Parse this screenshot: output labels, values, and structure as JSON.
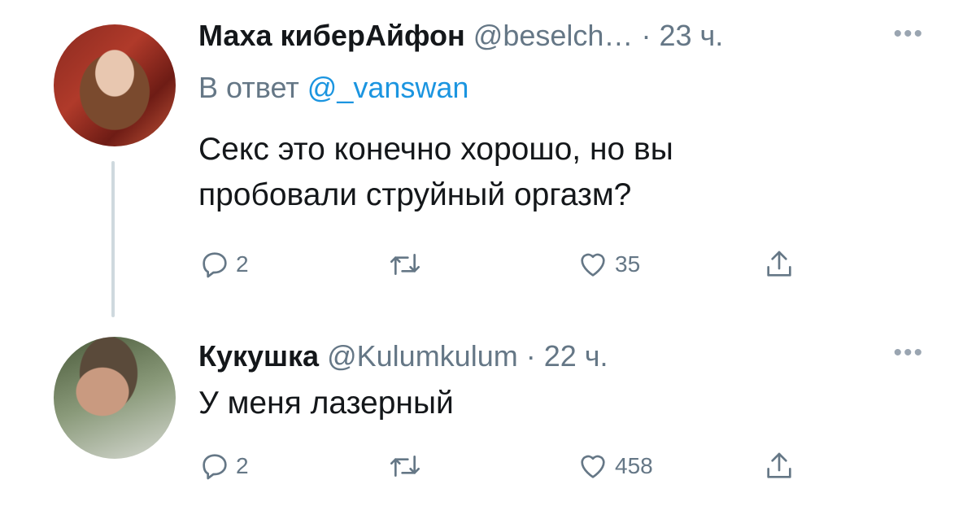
{
  "tweets": [
    {
      "name": "Маха киберАйфон",
      "handle": "@beselch…",
      "separator": "·",
      "time": "23 ч.",
      "more": "•••",
      "reply_prefix": "В ответ",
      "reply_mention": "@_vanswan",
      "text_line1": "Секс это конечно хорошо, но вы",
      "text_line2": "пробовали струйный оргазм?",
      "replies": "2",
      "likes": "35"
    },
    {
      "name": "Кукушка",
      "handle": "@Kulumkulum",
      "separator": "·",
      "time": "22 ч.",
      "more": "•••",
      "text_line1": "У меня лазерный",
      "replies": "2",
      "likes": "458"
    }
  ],
  "icons": {
    "reply": "reply-icon",
    "retweet": "retweet-icon",
    "like": "heart-icon",
    "share": "share-icon"
  },
  "colors": {
    "text": "#14171a",
    "secondary": "#657786",
    "link": "#1b95e0",
    "thread_line": "#cfd9de"
  }
}
